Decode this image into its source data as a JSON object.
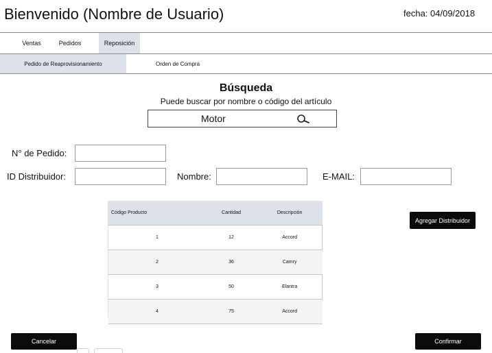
{
  "header": {
    "title": "Bienvenido (Nombre de Usuario)",
    "date": "fecha: 04/09/2018"
  },
  "tabs": [
    {
      "label": "Ventas",
      "active": false
    },
    {
      "label": "Pedidos",
      "active": false
    },
    {
      "label": "Reposición",
      "active": true
    }
  ],
  "subtabs": [
    {
      "label": "Pedido de Reaprovisionamiento",
      "active": true
    },
    {
      "label": "Orden de Compra",
      "active": false
    }
  ],
  "search": {
    "title": "Búsqueda",
    "subtitle": "Puede buscar por nombre o código del artículo",
    "value": "Motor",
    "icon": "search-icon"
  },
  "form": {
    "pedido_label": "N° de Pedido:",
    "pedido_value": "",
    "distribuidor_label": "ID Distribuidor:",
    "distribuidor_value": "",
    "nombre_label": "Nombre:",
    "nombre_value": "",
    "email_label": "E-MAIL:",
    "email_value": ""
  },
  "table": {
    "headers": [
      "Código Producto",
      "Cantidad",
      "Descripción"
    ],
    "rows": [
      [
        "1",
        "12",
        "Accord"
      ],
      [
        "2",
        "36",
        "Camry"
      ],
      [
        "3",
        "50",
        "Elantra"
      ],
      [
        "4",
        "75",
        "Accord"
      ]
    ]
  },
  "buttons": {
    "add_distributor": "Agregar Distribuidor",
    "cancel": "Cancelar",
    "confirm": "Confirmar"
  },
  "colors": {
    "active_tab": "#dde2ea",
    "button_bg": "#0b0b0b",
    "row_alt": "#f3f4f6"
  }
}
